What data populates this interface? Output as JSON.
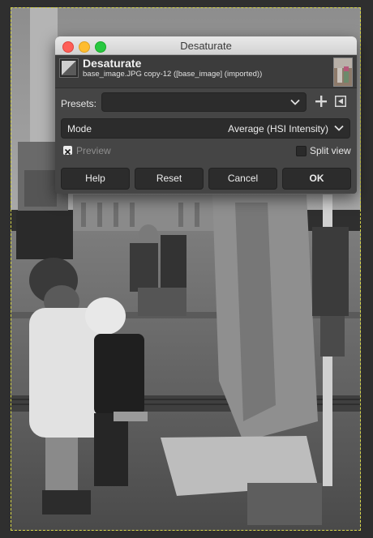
{
  "window": {
    "title": "Desaturate"
  },
  "header": {
    "title": "Desaturate",
    "subtitle": "base_image.JPG copy-12 ([base_image] (imported))"
  },
  "presets": {
    "label": "Presets:",
    "value": ""
  },
  "mode": {
    "label": "Mode",
    "value": "Average (HSI Intensity)"
  },
  "preview": {
    "label": "Preview",
    "checked": true
  },
  "split_view": {
    "label": "Split view",
    "checked": false
  },
  "buttons": {
    "help": "Help",
    "reset": "Reset",
    "cancel": "Cancel",
    "ok": "OK"
  },
  "icons": {
    "operation": "desaturate-icon",
    "add_preset": "plus-icon",
    "preset_menu": "menu-arrow-icon",
    "dropdown": "chevron-down-icon"
  },
  "colors": {
    "dialog_bg": "#454545",
    "selection_border": "#d9d84a",
    "close": "#fe5f57",
    "minimize": "#febc2e",
    "maximize": "#28c840"
  }
}
